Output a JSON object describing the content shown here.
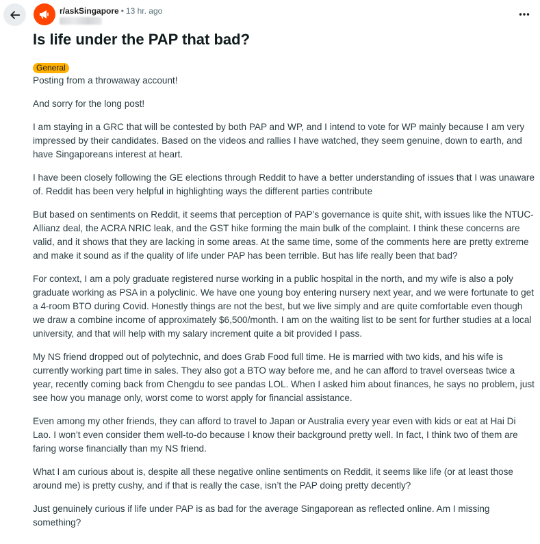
{
  "header": {
    "subreddit": "r/askSingapore",
    "separator": "•",
    "time_ago": "13 hr. ago"
  },
  "post": {
    "title": "Is life under the PAP that bad?",
    "flair": "General",
    "paragraphs": [
      "Posting from a throwaway account!",
      "And sorry for the long post!",
      "I am staying in a GRC that will be contested by both PAP and WP, and I intend to vote for WP mainly because I am very impressed by their candidates. Based on the videos and rallies I have watched, they seem genuine, down to earth, and have Singaporeans interest at heart.",
      "I have been closely following the GE elections through Reddit to have a better understanding of issues that I was unaware of. Reddit has been very helpful in highlighting ways the different parties contribute",
      "But based on sentiments on Reddit, it seems that perception of PAP’s governance is quite shit, with issues like the NTUC-Allianz deal, the ACRA NRIC leak, and the GST hike forming the main bulk of the complaint. I think these concerns are valid, and it shows that they are lacking in some areas. At the same time, some of the comments here are pretty extreme and make it sound as if the quality of life under PAP has been terrible. But has life really been that bad?",
      "For context, I am a poly graduate registered nurse working in a public hospital in the north, and my wife is also a poly graduate working as PSA in a polyclinic. We have one young boy entering nursery next year, and we were fortunate to get a 4-room BTO during Covid. Honestly things are not the best, but we live simply and are quite comfortable even though we draw a combine income of approximately $6,500/month. I am on the waiting list to be sent for further studies at a local university, and that will help with my salary increment quite a bit provided I pass.",
      "My NS friend dropped out of polytechnic, and does Grab Food full time. He is married with two kids, and his wife is currently working part time in sales. They also got a BTO way before me, and he can afford to travel overseas twice a year, recently coming back from Chengdu to see pandas LOL. When I asked him about finances, he says no problem, just see how you manage only, worst come to worst apply for financial assistance.",
      "Even among my other friends, they can afford to travel to Japan or Australia every year even with kids or eat at Hai Di Lao. I won’t even consider them well-to-do because I know their background pretty well. In fact, I think two of them are faring worse financially than my NS friend.",
      "What I am curious about is, despite all these negative online sentiments on Reddit, it seems like life (or at least those around me) is pretty cushy, and if that is really the case, isn’t the PAP doing pretty decently?",
      "Just genuinely curious if life under PAP is as bad for the average Singaporean as reflected online. Am I missing something?"
    ]
  },
  "icons": {
    "back": "arrow-left-icon",
    "subreddit": "megaphone-icon",
    "more": "more-horizontal-icon"
  },
  "colors": {
    "accent": "#ff4500",
    "flair_bg": "#ffb000",
    "back_btn_bg": "#eaedef",
    "body_text": "#2a3c42",
    "meta_text": "#576f76"
  }
}
